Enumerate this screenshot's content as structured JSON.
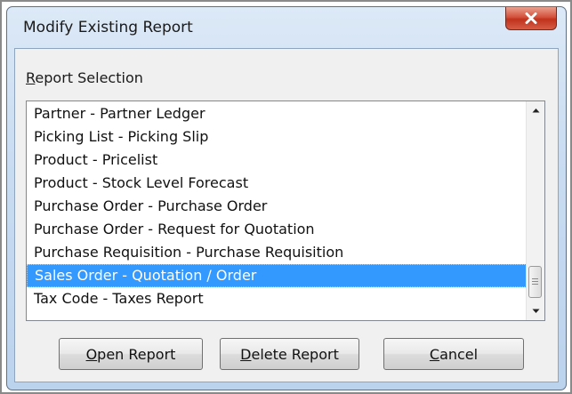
{
  "window": {
    "title": "Modify Existing Report"
  },
  "group": {
    "label_mnemonic": "R",
    "label_rest": "eport Selection"
  },
  "list": {
    "items": [
      "Partner - Partner Ledger",
      "Picking List - Picking Slip",
      "Product - Pricelist",
      "Product - Stock Level Forecast",
      "Purchase Order - Purchase Order",
      "Purchase Order - Request for Quotation",
      "Purchase Requisition - Purchase Requisition",
      "Sales Order - Quotation / Order",
      "Tax Code - Taxes Report"
    ],
    "selected_index": 7,
    "selected_item": "Sales Order - Quotation / Order"
  },
  "buttons": {
    "open": {
      "mnemonic": "O",
      "rest": "pen Report"
    },
    "delete": {
      "mnemonic": "D",
      "rest": "elete Report"
    },
    "cancel": {
      "mnemonic": "C",
      "rest": "ancel"
    }
  },
  "icons": {
    "close": "close-x-icon",
    "scroll_up": "arrow-up-icon",
    "scroll_down": "arrow-down-icon",
    "thumb_grip": "grip-icon"
  },
  "colors": {
    "selection": "#3399ff",
    "close_button": "#c0321c",
    "window_frame": "#c9dcf1"
  }
}
